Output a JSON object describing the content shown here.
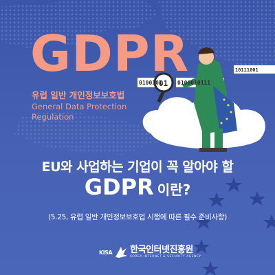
{
  "hero": {
    "title": "GDPR",
    "subtitle_kr": "유럽 일반 개인정보보호법",
    "subtitle_en": "General Data Protection Regulation"
  },
  "illustration": {
    "binary_left": "0100101",
    "binary_center": "01",
    "binary_right": "0100010111",
    "binary_top": "10111001"
  },
  "headline": {
    "line1": "EU와 사업하는 기업이 꼭 알아야 할",
    "line2_big": "GDPR",
    "line2_small": "이란?"
  },
  "note": "(5.25, 유럽 일반 개인정보보호법 시행에 따른 필수 준비사항)",
  "logo": {
    "mark": "KISA",
    "name": "한국인터넷진흥원",
    "tagline": "KOREA INTERNET & SECURITY AGENCY"
  },
  "colors": {
    "background": "#4762b4",
    "accent": "#f59b85",
    "star": "#2f4596",
    "text": "#ffffff"
  },
  "icons": [
    "magnifier-icon",
    "eu-stars-icon",
    "kisa-logo-icon"
  ]
}
